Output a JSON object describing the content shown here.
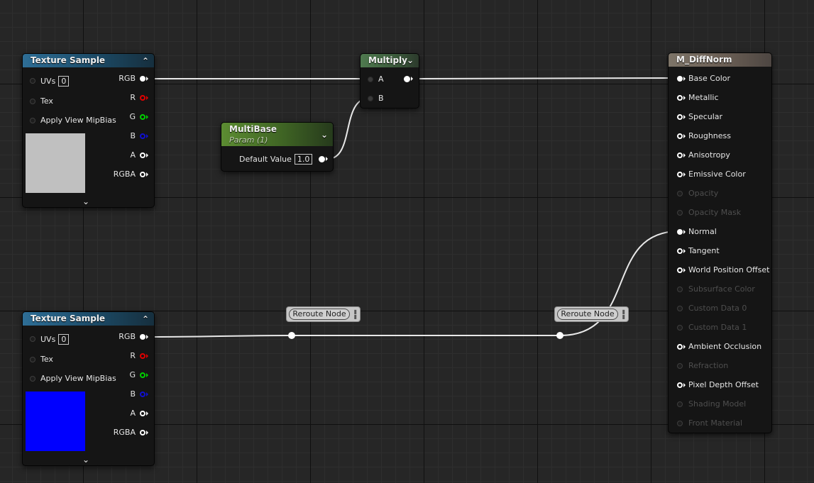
{
  "colors": {
    "texture_header": "#1c4a66",
    "multiply_header": "#3b5a3b",
    "param_header": "#3f6424",
    "material_header": "#6a5e54",
    "wire": "#e8e8e8",
    "swatch_top": "#c0c0c0",
    "swatch_bottom": "#0000ff"
  },
  "texture_sample_top": {
    "title": "Texture Sample",
    "inputs": [
      "UVs",
      "Tex",
      "Apply View MipBias"
    ],
    "uvs_value": "0",
    "outputs": [
      "RGB",
      "R",
      "G",
      "B",
      "A",
      "RGBA"
    ]
  },
  "texture_sample_bottom": {
    "title": "Texture Sample",
    "inputs": [
      "UVs",
      "Tex",
      "Apply View MipBias"
    ],
    "uvs_value": "0",
    "outputs": [
      "RGB",
      "R",
      "G",
      "B",
      "A",
      "RGBA"
    ]
  },
  "multiply": {
    "title": "Multiply",
    "inputs": [
      "A",
      "B"
    ]
  },
  "multibase": {
    "title": "MultiBase",
    "subtitle": "Param (1)",
    "default_label": "Default Value",
    "default_value": "1.0"
  },
  "reroute": {
    "label": "Reroute Node"
  },
  "material": {
    "title": "M_DiffNorm",
    "pins": [
      {
        "label": "Base Color",
        "enabled": true
      },
      {
        "label": "Metallic",
        "enabled": true
      },
      {
        "label": "Specular",
        "enabled": true
      },
      {
        "label": "Roughness",
        "enabled": true
      },
      {
        "label": "Anisotropy",
        "enabled": true
      },
      {
        "label": "Emissive Color",
        "enabled": true
      },
      {
        "label": "Opacity",
        "enabled": false
      },
      {
        "label": "Opacity Mask",
        "enabled": false
      },
      {
        "label": "Normal",
        "enabled": true
      },
      {
        "label": "Tangent",
        "enabled": true
      },
      {
        "label": "World Position Offset",
        "enabled": true
      },
      {
        "label": "Subsurface Color",
        "enabled": false
      },
      {
        "label": "Custom Data 0",
        "enabled": false
      },
      {
        "label": "Custom Data 1",
        "enabled": false
      },
      {
        "label": "Ambient Occlusion",
        "enabled": true
      },
      {
        "label": "Refraction",
        "enabled": false
      },
      {
        "label": "Pixel Depth Offset",
        "enabled": true
      },
      {
        "label": "Shading Model",
        "enabled": false
      },
      {
        "label": "Front Material",
        "enabled": false
      }
    ]
  }
}
